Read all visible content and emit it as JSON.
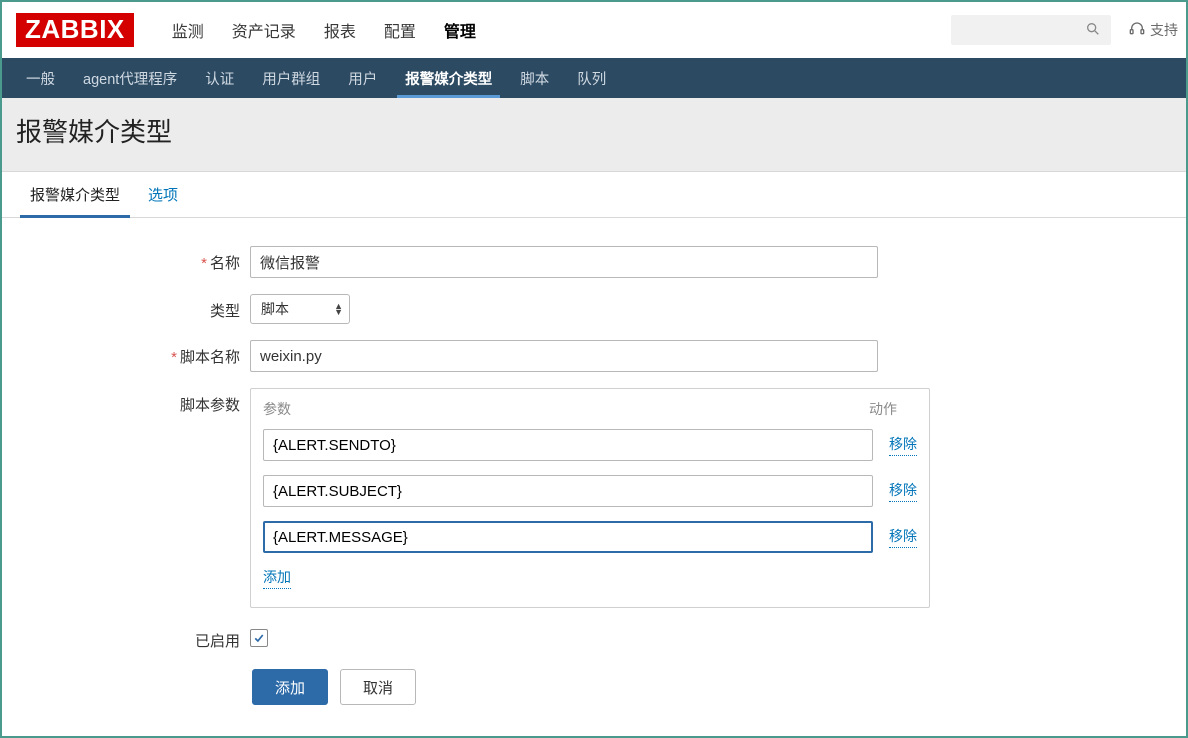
{
  "logo_text": "ZABBIX",
  "top_nav": {
    "items": [
      "监测",
      "资产记录",
      "报表",
      "配置",
      "管理"
    ],
    "active_index": 4
  },
  "top_right": {
    "support_label": "支持"
  },
  "sub_nav": {
    "items": [
      "一般",
      "agent代理程序",
      "认证",
      "用户群组",
      "用户",
      "报警媒介类型",
      "脚本",
      "队列"
    ],
    "active_index": 5
  },
  "page_title": "报警媒介类型",
  "tabs": {
    "items": [
      "报警媒介类型",
      "选项"
    ],
    "active_index": 0
  },
  "form": {
    "name_label": "名称",
    "name_value": "微信报警",
    "type_label": "类型",
    "type_value": "脚本",
    "script_name_label": "脚本名称",
    "script_name_value": "weixin.py",
    "params_label": "脚本参数",
    "params_header_param": "参数",
    "params_header_action": "动作",
    "params": [
      {
        "value": "{ALERT.SENDTO}",
        "remove_label": "移除"
      },
      {
        "value": "{ALERT.SUBJECT}",
        "remove_label": "移除"
      },
      {
        "value": "{ALERT.MESSAGE}",
        "remove_label": "移除"
      }
    ],
    "add_param_label": "添加",
    "enabled_label": "已启用",
    "enabled_checked": true,
    "submit_label": "添加",
    "cancel_label": "取消"
  }
}
